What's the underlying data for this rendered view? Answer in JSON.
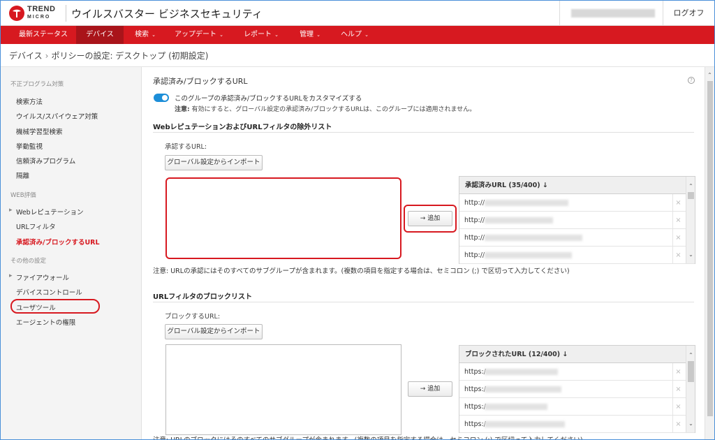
{
  "header": {
    "brand": "TREND",
    "brand_sub": "MICRO",
    "app_title": "ウイルスバスター ビジネスセキュリティ",
    "logout": "ログオフ"
  },
  "nav": [
    {
      "label": "最新ステータス",
      "dropdown": false
    },
    {
      "label": "デバイス",
      "dropdown": false,
      "active": true
    },
    {
      "label": "検索",
      "dropdown": true
    },
    {
      "label": "アップデート",
      "dropdown": true
    },
    {
      "label": "レポート",
      "dropdown": true
    },
    {
      "label": "管理",
      "dropdown": true
    },
    {
      "label": "ヘルプ",
      "dropdown": true
    }
  ],
  "breadcrumb": {
    "parent": "デバイス",
    "sep": "›",
    "current": "ポリシーの設定: デスクトップ (初期設定)"
  },
  "sidebar": {
    "sections": [
      "不正プログラム対策",
      "WEB評価",
      "その他の設定"
    ],
    "items": [
      "検索方法",
      "ウイルス/スパイウェア対策",
      "機械学習型検索",
      "挙動監視",
      "信頼済みプログラム",
      "隔離",
      "Webレピュテーション",
      "URLフィルタ",
      "承認済み/ブロックするURL",
      "ファイアウォール",
      "デバイスコントロール",
      "ユーザツール",
      "エージェントの権限"
    ]
  },
  "main": {
    "title": "承認済み/ブロックするURL",
    "help": "?",
    "toggle_label": "このグループの承認済み/ブロックするURLをカスタマイズする",
    "toggle_on": true,
    "note_prefix": "注意:",
    "note_text": "有効にすると、グローバル設定の承認済み/ブロックするURLは、このグループには適用されません。",
    "approved": {
      "heading": "WebレピュテーションおよびURLフィルタの除外リスト",
      "label": "承認するURL:",
      "import_button": "グローバル設定からインポート",
      "add_button": "→ 追加",
      "table_header": "承認済みURL (35/400) ↓",
      "rows": [
        "http://",
        "http://",
        "http://",
        "http://"
      ],
      "note": "注意: URLの承認にはそのすべてのサブグループが含まれます。(複数の項目を指定する場合は、セミコロン (;) で区切って入力してください)"
    },
    "blocked": {
      "heading": "URLフィルタのブロックリスト",
      "label": "ブロックするURL:",
      "import_button": "グローバル設定からインポート",
      "add_button": "→ 追加",
      "table_header": "ブロックされたURL (12/400) ↓",
      "rows": [
        "https:/",
        "https:/",
        "https:/",
        "https:/"
      ],
      "note": "注意: URLのブロックにはそのすべてのサブグループが含まれます。(複数の項目を指定する場合は、セミコロン (;) で区切って入力してください)"
    }
  },
  "icons": {
    "remove": "×",
    "scroll_up": "⌃",
    "scroll_down": "⌄"
  },
  "colors": {
    "brand_red": "#d71920",
    "toggle_blue": "#1d8ed8"
  }
}
